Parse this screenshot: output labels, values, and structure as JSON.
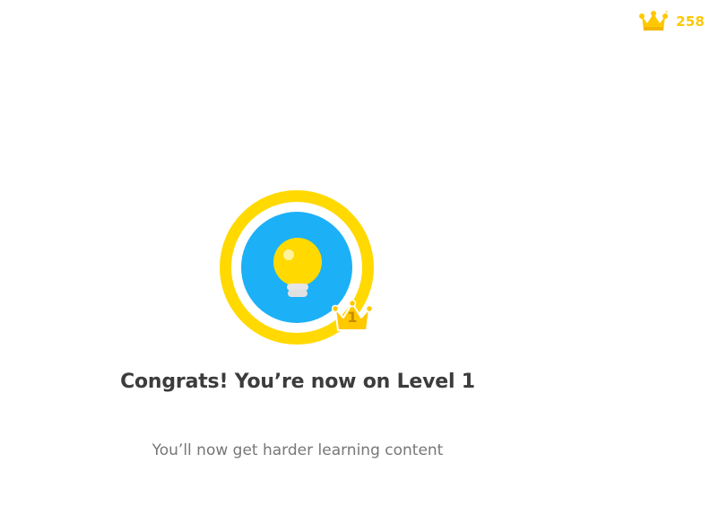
{
  "header": {
    "crown_icon": "crown-icon",
    "crown_count": "258",
    "crown_color": "#ffc800"
  },
  "badge": {
    "icon": "lightbulb-icon",
    "ring_color": "#ffd900",
    "inner_color": "#1cb0f6",
    "bulb_color": "#ffd900",
    "level_crown_icon": "crown-icon",
    "level": "1"
  },
  "main": {
    "title": "Congrats! You’re now on Level 1",
    "subtitle": "You’ll now get harder learning content"
  }
}
